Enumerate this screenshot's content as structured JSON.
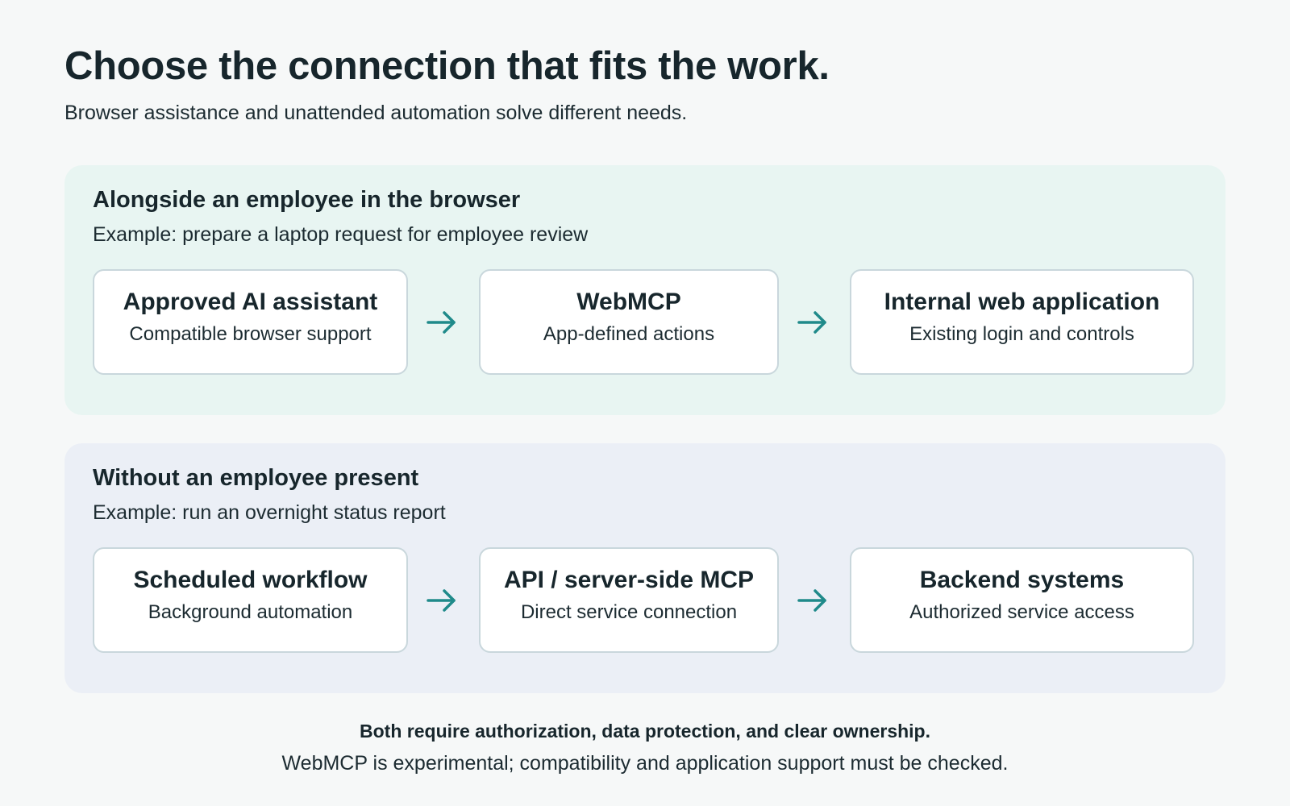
{
  "header": {
    "title": "Choose the connection that fits the work.",
    "subtitle": "Browser assistance and unattended automation solve different needs."
  },
  "panels": [
    {
      "heading": "Alongside an employee in the browser",
      "example": "Example: prepare a laptop request for employee review",
      "nodes": [
        {
          "title": "Approved AI assistant",
          "subtitle": "Compatible browser support"
        },
        {
          "title": "WebMCP",
          "subtitle": "App-defined actions"
        },
        {
          "title": "Internal web application",
          "subtitle": "Existing login and controls"
        }
      ]
    },
    {
      "heading": "Without an employee present",
      "example": "Example: run an overnight status report",
      "nodes": [
        {
          "title": "Scheduled workflow",
          "subtitle": "Background automation"
        },
        {
          "title": "API / server-side MCP",
          "subtitle": "Direct service connection"
        },
        {
          "title": "Backend systems",
          "subtitle": "Authorized service access"
        }
      ]
    }
  ],
  "footer": {
    "emphasis": "Both require authorization, data protection, and clear ownership.",
    "note": "WebMCP is experimental; compatibility and application support must be checked."
  },
  "colors": {
    "arrow": "#1f8a8a",
    "browser_panel_bg": "#e8f5f2",
    "unattended_panel_bg": "#ebeff6"
  },
  "icons": {
    "flow_arrow": "arrow-right-icon"
  }
}
